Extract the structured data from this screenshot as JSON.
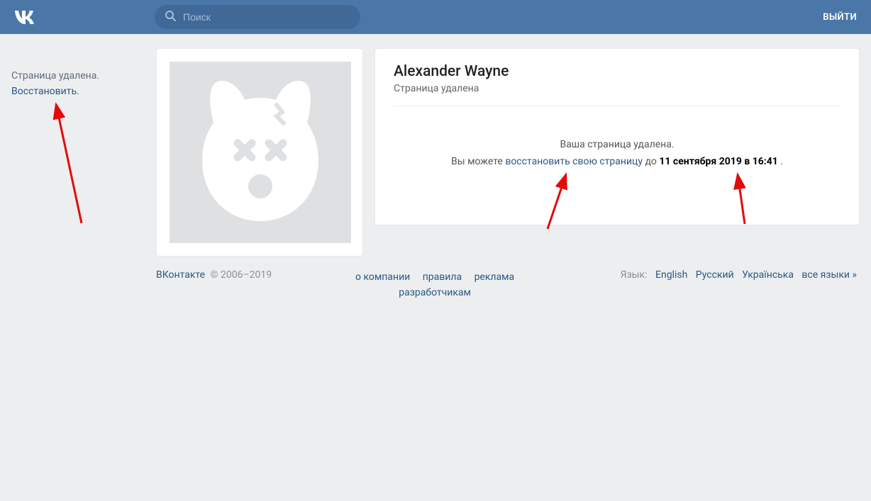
{
  "header": {
    "search_placeholder": "Поиск",
    "logout": "ВЫЙТИ"
  },
  "sidebar": {
    "deleted_text": "Страница удалена.",
    "restore_text": "Восстановить."
  },
  "profile": {
    "name": "Alexander Wayne",
    "status": "Страница удалена",
    "notice_line1": "Ваша страница удалена.",
    "notice_prefix": "Вы можете ",
    "notice_link": "восстановить свою страницу",
    "notice_middle": " до ",
    "notice_date": "11 сентября 2019 в 16:41",
    "notice_suffix": "."
  },
  "footer": {
    "brand": "ВКонтакте",
    "copyright": " © 2006–2019",
    "links": {
      "about": "о компании",
      "rules": "правила",
      "ads": "реклама",
      "devs": "разработчикам"
    },
    "language_label": "Язык:",
    "languages": {
      "en": "English",
      "ru": "Русский",
      "uk": "Українська",
      "all": "все языки »"
    }
  }
}
